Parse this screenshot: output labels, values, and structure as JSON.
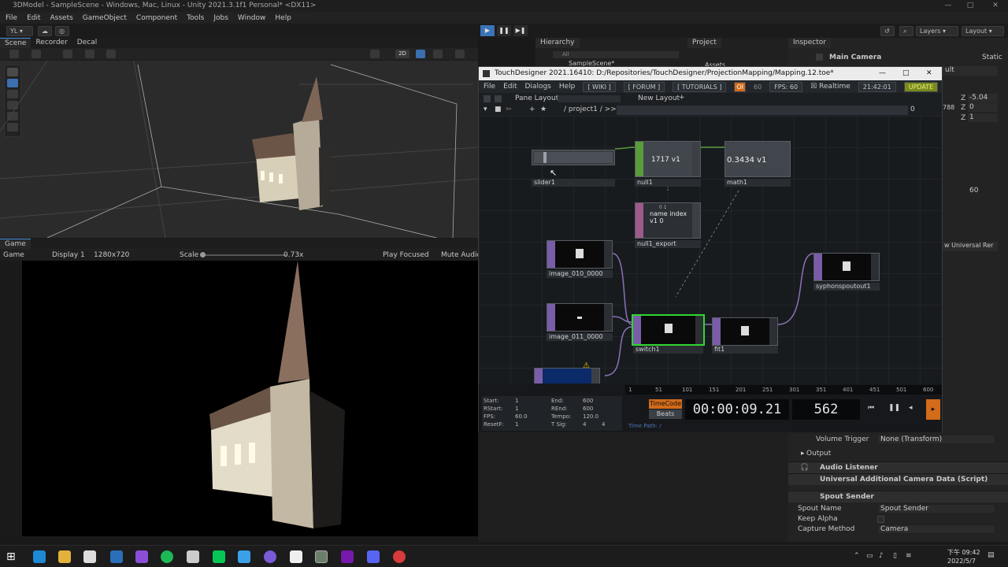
{
  "window": {
    "title": "3DModel - SampleScene - Windows, Mac, Linux - Unity 2021.3.1f1 Personal* <DX11>"
  },
  "menu": [
    "File",
    "Edit",
    "Assets",
    "GameObject",
    "Component",
    "Tools",
    "Jobs",
    "Window",
    "Help"
  ],
  "toolbar": {
    "account": "YL ▾",
    "layers": "Layers",
    "layout": "Layout"
  },
  "scene_tabs": [
    "Scene",
    "Recorder",
    "Decal"
  ],
  "scene_toggle": "2D",
  "game": {
    "tab": "Game",
    "display_mode": "Game",
    "display": "Display 1",
    "resolution": "1280x720",
    "scale_label": "Scale",
    "scale_value": "0.73x",
    "play_focused": "Play Focused",
    "mute_audio": "Mute Audio"
  },
  "hierarchy": {
    "tab": "Hierarchy",
    "search": "All",
    "item": "SampleScene*"
  },
  "project": {
    "tab": "Project",
    "item": "Assets"
  },
  "inspector": {
    "tab": "Inspector",
    "object_name": "Main Camera",
    "static": "Static",
    "preset": "ult",
    "z1": "-5.04",
    "z1_label": "Z",
    "v788": "788",
    "z2": "0",
    "z2_label": "Z",
    "z3": "1",
    "z3_label": "Z",
    "num60": "60",
    "renderer": "w Universal Rer",
    "volume_trigger_label": "Volume Trigger",
    "volume_trigger_value": "None (Transform)",
    "output": "Output",
    "audio_listener": "Audio Listener",
    "camera_data": "Universal Additional Camera Data (Script)",
    "spout_sender": "Spout Sender",
    "spout_name_label": "Spout Name",
    "spout_name_value": "Spout Sender",
    "keep_alpha": "Keep Alpha",
    "capture_method_label": "Capture Method",
    "capture_method_value": "Camera"
  },
  "touchdesigner": {
    "title": "TouchDesigner 2021.16410: D:/Repositories/TouchDesigner/ProjectionMapping/Mapping.12.toe*",
    "menu": [
      "File",
      "Edit",
      "Dialogs",
      "Help"
    ],
    "buttons": [
      "[ WIKI ]",
      "[ FORUM ]",
      "[ TUTORIALS ]"
    ],
    "oi": "OI",
    "fps60": "60",
    "fps": "FPS: 60",
    "realtime": "Realtime",
    "clock": "21:42:01",
    "update": "UPDATE",
    "pane_layout": "Pane Layout",
    "new_layout": "New Layout",
    "path": "/ project1 / >>",
    "path_count": "0",
    "nodes": {
      "slider1": "slider1",
      "null1": "null1",
      "null1_value": "1717 v1",
      "math1": "math1",
      "math1_value": "0.3434 v1",
      "null1_export": "null1_export",
      "export_header": "0        1",
      "export_r1": "name  index",
      "export_r2": "v1    0",
      "image_010": "image_010_0000",
      "image_011": "image_011_0000",
      "switch1": "switch1",
      "fit1": "fit1",
      "syphon": "syphonspoutout1"
    },
    "timeline_ticks": [
      "1",
      "51",
      "101",
      "151",
      "201",
      "251",
      "301",
      "351",
      "401",
      "451",
      "501",
      "600"
    ],
    "time_info": {
      "start_label": "Start:",
      "start": "1",
      "end_label": "End:",
      "end": "600",
      "rstart_label": "RStart:",
      "rstart": "1",
      "rend_label": "REnd:",
      "rend": "600",
      "fps_label": "FPS:",
      "fps": "60.0",
      "tempo_label": "Tempo:",
      "tempo": "120.0",
      "resetf_label": "ResetF:",
      "resetf": "1",
      "tsig_label": "T Sig:",
      "tsig1": "4",
      "tsig2": "4"
    },
    "timecode_label": "TimeCode",
    "beats_label": "Beats",
    "timecode": "00:00:09.21",
    "frame": "562",
    "time_path": "Time Path: /"
  },
  "taskbar": {
    "time": "下午 09:42",
    "date": "2022/5/7"
  },
  "colors": {
    "td_chop": "#5a9c3a",
    "td_top": "#7a5da8",
    "td_selected": "#2fd62f",
    "unity_accent": "#4a90e2"
  }
}
